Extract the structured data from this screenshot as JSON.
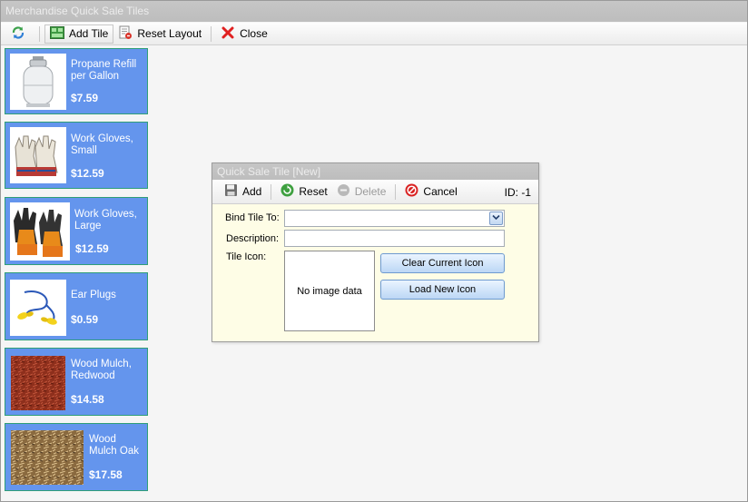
{
  "window": {
    "title": "Merchandise Quick Sale Tiles"
  },
  "toolbar": {
    "add_tile_label": "Add Tile",
    "reset_layout_label": "Reset Layout",
    "close_label": "Close"
  },
  "tiles": [
    {
      "name": "Propane Refill per Gallon",
      "price": "$7.59",
      "icon": "propane-tank-image"
    },
    {
      "name": "Work Gloves, Small",
      "price": "$12.59",
      "icon": "work-gloves-small-image"
    },
    {
      "name": "Work Gloves, Large",
      "price": "$12.59",
      "icon": "work-gloves-large-image"
    },
    {
      "name": "Ear Plugs",
      "price": "$0.59",
      "icon": "ear-plugs-image"
    },
    {
      "name": "Wood Mulch, Redwood",
      "price": "$14.58",
      "icon": "redwood-mulch-image"
    },
    {
      "name": "Wood Mulch Oak",
      "price": "$17.58",
      "icon": "oak-mulch-image"
    }
  ],
  "dialog": {
    "title": "Quick Sale Tile [New]",
    "add_label": "Add",
    "reset_label": "Reset",
    "delete_label": "Delete",
    "cancel_label": "Cancel",
    "id_label": "ID: -1",
    "bind_label": "Bind Tile To:",
    "bind_value": "",
    "description_label": "Description:",
    "description_value": "",
    "icon_label": "Tile Icon:",
    "no_image_text": "No image data",
    "clear_icon_label": "Clear Current Icon",
    "load_icon_label": "Load New Icon"
  },
  "colors": {
    "tile_bg": "#6495ed",
    "tile_border": "#2f9e78",
    "dialog_bg": "#fefde6"
  }
}
